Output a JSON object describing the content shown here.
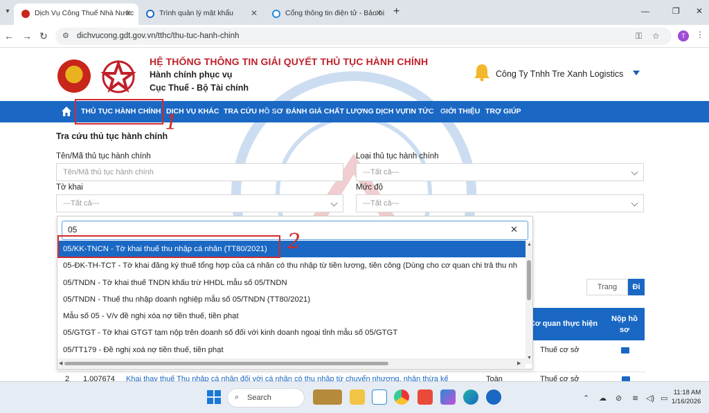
{
  "browser": {
    "tabs": [
      {
        "title": "Dịch Vụ Công Thuế Nhà Nước",
        "active": true
      },
      {
        "title": "Trình quản lý mật khẩu",
        "active": false
      },
      {
        "title": "Cổng thông tin điện tử - Bảo hi",
        "active": false
      }
    ],
    "url": "dichvucong.gdt.gov.vn/tthc/thu-tuc-hanh-chinh",
    "profile_initial": "T"
  },
  "header": {
    "system_title": "HỆ THỐNG THÔNG TIN GIẢI QUYẾT THỦ TỤC HÀNH CHÍNH",
    "subtitle1": "Hành chính phục vụ",
    "subtitle2": "Cục Thuế - Bộ Tài chính",
    "company": "Công Ty Tnhh Tre Xanh Logistics"
  },
  "nav": {
    "items": [
      "THỦ TỤC HÀNH CHÍNH",
      "DỊCH VỤ KHÁC",
      "TRA CỨU HỒ SƠ",
      "ĐÁNH GIÁ CHẤT LƯỢNG DỊCH VỤ",
      "TIN TỨC",
      "GIỚI THIỆU",
      "TRỢ GIÚP"
    ]
  },
  "annotations": {
    "one": "1",
    "two": "2"
  },
  "form": {
    "section_title": "Tra cứu thủ tục hành chính",
    "ten_label": "Tên/Mã thủ tục hành chính",
    "ten_placeholder": "Tên/Mã thủ tục hành chính",
    "loai_label": "Loại thủ tục hành chính",
    "loai_value": "---Tất cả---",
    "tokhai_label": "Tờ khai",
    "tokhai_value": "---Tất cả---",
    "mucdo_label": "Mức độ",
    "mucdo_value": "---Tất cả---"
  },
  "dropdown": {
    "search_value": "05",
    "items": [
      "05/KK-TNCN - Tờ khai thuế thu nhập cá nhân (TT80/2021)",
      "05-ĐK-TH-TCT - Tờ khai đăng ký thuế tổng hợp của cá nhân có thu nhập từ tiền lương, tiền công (Dùng cho cơ quan chi trả thu nh",
      "05/TNDN - Tờ khai thuế TNDN khấu trừ HHDL mẫu số 05/TNDN",
      "05/TNDN - Thuế thu nhập doanh nghiệp mẫu số 05/TNDN (TT80/2021)",
      "Mẫu số 05 - V/v đề nghị xóa nợ tiền thuế, tiền phạt",
      "05/GTGT - Tờ khai GTGT tạm nộp trên doanh số đối với kinh doanh ngoại tỉnh mẫu số 05/GTGT",
      "05/TT179 - Đề nghị xoá nợ tiền thuế, tiền phạt"
    ]
  },
  "paging": {
    "trang_placeholder": "Trang",
    "go_label": "Đi"
  },
  "table": {
    "col_agency": "Cơ quan thực hiện",
    "col_submit": "Nộp hồ sơ",
    "row1_agency": "Thuế cơ sở",
    "row2": {
      "index": "2",
      "code": "1.007674",
      "name": "Khai thay thuế Thu nhập cá nhân đối với cá nhân có thu nhập từ chuyển nhượng, nhận thừa kế",
      "level": "Toàn",
      "agency": "Thuế cơ sở"
    }
  },
  "taskbar": {
    "search_label": "Search",
    "time": "11:18 AM",
    "date": "1/16/2026"
  },
  "colors": {
    "primary": "#1a68c4",
    "brand_red": "#c0202a",
    "annotation_red": "#d12b2b"
  }
}
